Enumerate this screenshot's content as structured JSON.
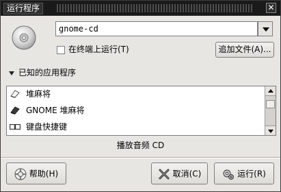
{
  "window": {
    "title": "运行程序",
    "close_label": "✕"
  },
  "command": {
    "value": "gnome-cd"
  },
  "terminal_checkbox": {
    "label": "在终端上运行(T)",
    "checked": false
  },
  "add_file_button": {
    "label": "追加文件(A)..."
  },
  "known_apps": {
    "expander_label": "已知的应用程序",
    "items": [
      {
        "label": "堆麻将",
        "icon": "mahjongg-icon"
      },
      {
        "label": "GNOME 堆麻将",
        "icon": "mahjongg-icon"
      },
      {
        "label": "键盘快捷键",
        "icon": "keyboard-icon"
      }
    ]
  },
  "description": "播放音频 CD",
  "buttons": {
    "help": "帮助(H)",
    "cancel": "取消(C)",
    "run": "运行(R)"
  },
  "colors": {
    "titlebar": "#1a1a1a",
    "dialog_bg": "#e8e6e2"
  }
}
